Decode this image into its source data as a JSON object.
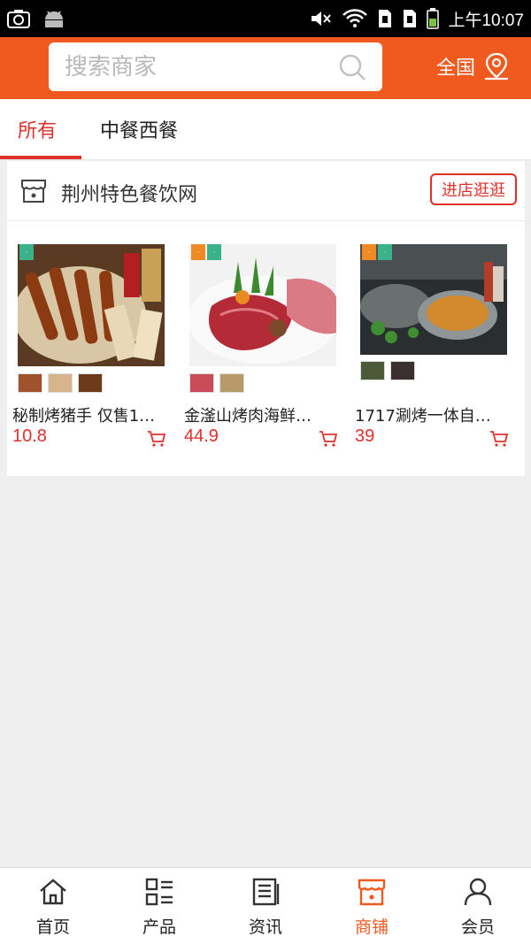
{
  "status_bar": {
    "time": "上午10:07"
  },
  "header": {
    "search_placeholder": "搜索商家",
    "region_label": "全国"
  },
  "tabs": [
    {
      "label": "所有",
      "active": true
    },
    {
      "label": "中餐西餐",
      "active": false
    }
  ],
  "shop": {
    "name": "荆州特色餐饮网",
    "visit_label": "进店逛逛",
    "products": [
      {
        "title": "秘制烤猪手 仅售1…",
        "price": "10.8"
      },
      {
        "title": "金滏山烤肉海鲜…",
        "price": "44.9"
      },
      {
        "title": "1717涮烤一体自…",
        "price": "39"
      }
    ]
  },
  "bottom_nav": [
    {
      "label": "首页",
      "icon": "home-icon",
      "active": false
    },
    {
      "label": "产品",
      "icon": "grid-list-icon",
      "active": false
    },
    {
      "label": "资讯",
      "icon": "news-icon",
      "active": false
    },
    {
      "label": "商铺",
      "icon": "shop-icon",
      "active": true
    },
    {
      "label": "会员",
      "icon": "user-icon",
      "active": false
    }
  ],
  "colors": {
    "brand_orange": "#f05a1f",
    "accent_red": "#e0302c"
  }
}
